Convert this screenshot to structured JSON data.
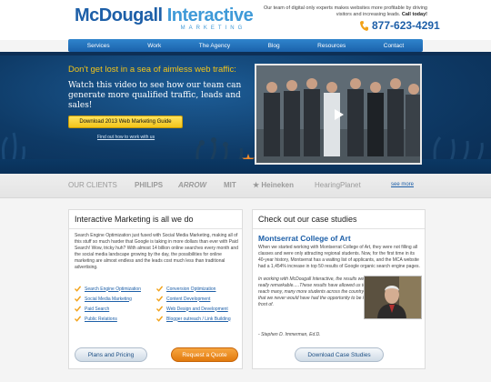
{
  "header": {
    "logo_main_1": "McDougall",
    "logo_main_2": "Interactive",
    "logo_sub": "MARKETING",
    "tagline": "Our team of digital only experts makes websites more profitable by driving visitors and increasing leads.",
    "tagline_cta": "Call today!",
    "phone": "877-623-4291",
    "icons": {
      "phone": "phone-icon"
    }
  },
  "nav": {
    "items": [
      "Services",
      "Work",
      "The Agency",
      "Blog",
      "Resources",
      "Contact"
    ]
  },
  "hero": {
    "headline": "Don't get lost in a sea of aimless web traffic:",
    "body": "Watch this video to see how our team can generate more qualified traffic, leads and sales!",
    "button": "Download 2013 Web Marketing Guide",
    "link": "Find out how to work with us",
    "icons": {
      "play": "play-icon"
    },
    "colors": {
      "accent": "#f2c41a",
      "background": "#0e3a66"
    }
  },
  "clients": {
    "label": "OUR CLIENTS",
    "logos": [
      "PHILIPS",
      "ARROW",
      "MIT",
      "Heineken",
      "HearingPlanet"
    ],
    "see_more": "see more"
  },
  "left_panel": {
    "title": "Interactive Marketing is all we do",
    "intro": "Search Engine Optimization just fused with Social Media Marketing, making all of this stuff so much harder that Google is taking in more dollars than ever with Paid Search! Wow, tricky huh? With almost 14 billion online searches every month and the social media landscape growing by the day, the possibilities for online marketing are almost endless and the leads cost much less than traditional advertising.",
    "services": [
      "Search Engine Optimization",
      "Conversion Optimization",
      "Social Media Marketing",
      "Content Development",
      "Paid Search",
      "Web Design and Development",
      "Public Relations",
      "Blogger outreach / Link Building"
    ],
    "plans_button": "Plans and Pricing",
    "quote_button": "Request a Quote"
  },
  "right_panel": {
    "title": "Check out our case studies",
    "case_heading": "Montserrat College of Art",
    "case_text": "When we started working with Montserrat College of Art, they were not filling all classes and were only attracting regional students. Now, for the first time in its 40-year history, Montserrat has a waiting list of applicants, and the MCA website had a 1,454% increase in top 50 results of Google organic search engine pages.",
    "quote": "In working with McDougall Interactive, the results were really remarkable.....These results have allowed us to reach many, many more students across the country that we never would have had the opportunity to be in front of.",
    "signature": "- Stephen D. Immerman, Ed.D.",
    "download_button": "Download Case Studies"
  },
  "colors": {
    "brand_blue": "#1d5fa8",
    "light_blue": "#3f9ad8",
    "orange": "#e27a0e",
    "yellow": "#f2c41a"
  }
}
